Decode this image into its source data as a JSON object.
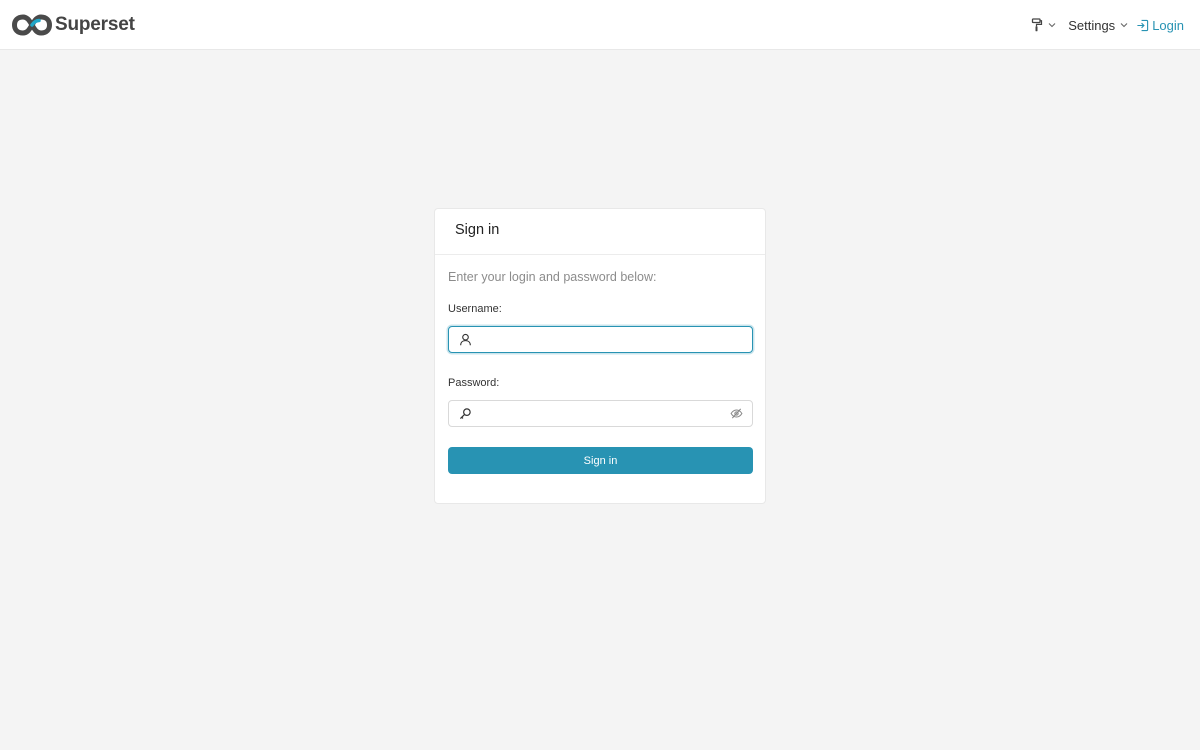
{
  "navbar": {
    "brand_name": "Superset",
    "settings_label": "Settings",
    "login_label": "Login",
    "icons": {
      "brand": "superset-logo-icon",
      "theme": "paint-roller-icon",
      "dropdown": "chevron-down-icon",
      "login": "login-icon"
    }
  },
  "login_card": {
    "title": "Sign in",
    "instructions": "Enter your login and password below:",
    "username": {
      "label": "Username:",
      "value": "",
      "placeholder": "",
      "icon": "user-icon"
    },
    "password": {
      "label": "Password:",
      "value": "",
      "placeholder": "",
      "icon": "key-icon",
      "toggle_icon": "eye-invisible-icon"
    },
    "submit_label": "Sign in"
  },
  "colors": {
    "accent": "#2893b3",
    "page_background": "#f4f4f4",
    "card_background": "#ffffff"
  }
}
